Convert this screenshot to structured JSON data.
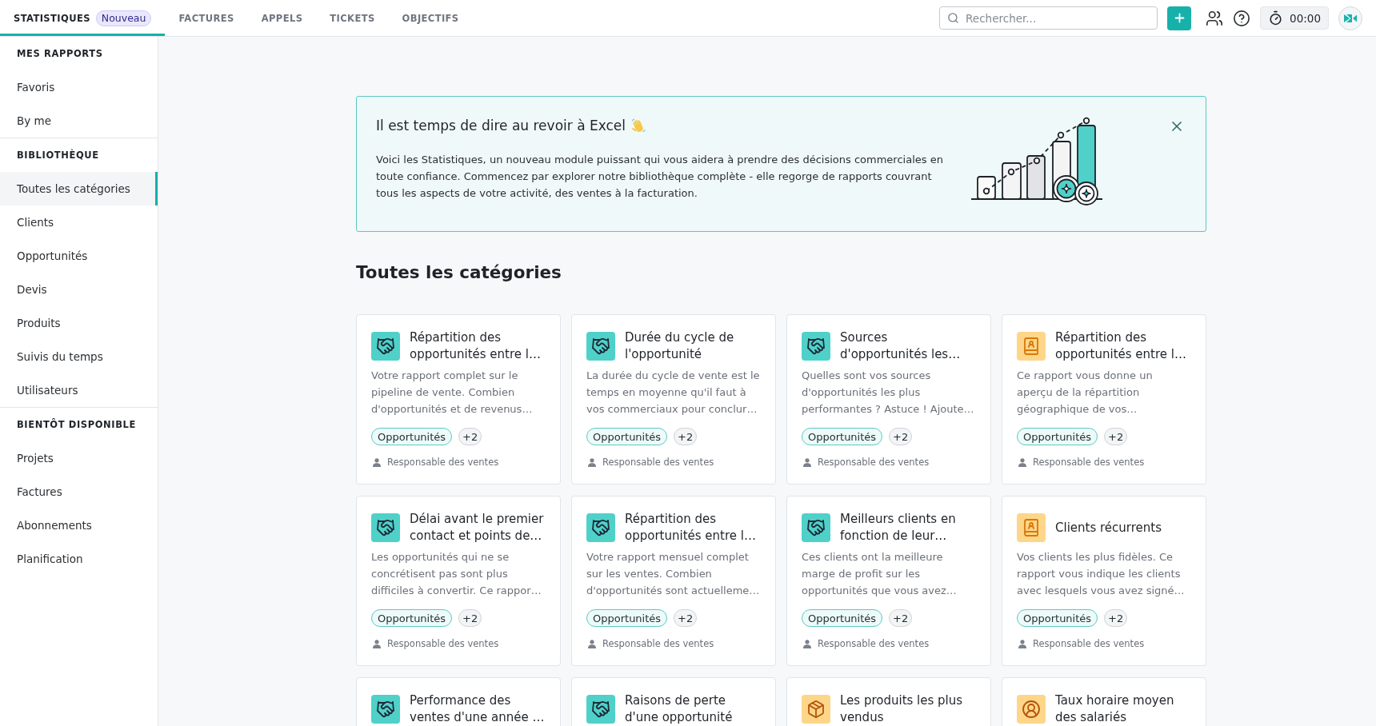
{
  "top_bar": {
    "tabs": [
      {
        "label": "STATISTIQUES",
        "badge": "Nouveau",
        "selected": true
      },
      {
        "label": "FACTURES",
        "selected": false
      },
      {
        "label": "APPELS",
        "selected": false
      },
      {
        "label": "TICKETS",
        "selected": false
      },
      {
        "label": "OBJECTIFS",
        "selected": false
      }
    ],
    "search": {
      "placeholder": "Rechercher..."
    },
    "timer": "00:00"
  },
  "sidebar": {
    "sections": [
      {
        "heading": "MES RAPPORTS",
        "items": [
          {
            "label": "Favoris",
            "selected": false
          },
          {
            "label": "By me",
            "selected": false
          }
        ]
      },
      {
        "heading": "BIBLIOTHÈQUE",
        "items": [
          {
            "label": "Toutes les catégories",
            "selected": true
          },
          {
            "label": "Clients",
            "selected": false
          },
          {
            "label": "Opportunités",
            "selected": false
          },
          {
            "label": "Devis",
            "selected": false
          },
          {
            "label": "Produits",
            "selected": false
          },
          {
            "label": "Suivis du temps",
            "selected": false
          },
          {
            "label": "Utilisateurs",
            "selected": false
          }
        ]
      },
      {
        "heading": "BIENTÔT DISPONIBLE",
        "items": [
          {
            "label": "Projets",
            "selected": false
          },
          {
            "label": "Factures",
            "selected": false
          },
          {
            "label": "Abonnements",
            "selected": false
          },
          {
            "label": "Planification",
            "selected": false
          }
        ]
      }
    ]
  },
  "banner": {
    "title": "Il est temps de dire au revoir à Excel",
    "text": "Voici les Statistiques, un nouveau module puissant qui vous aidera à prendre des décisions commerciales en toute confiance. Commencez par explorer notre bibliothèque complète - elle regorge de rapports couvrant tous les aspects de votre activité, des ventes à la facturation."
  },
  "library": {
    "heading": "Toutes les catégories",
    "cards": [
      {
        "kind": "deal",
        "title": "Répartition des opportunités entre l…",
        "description": "Votre rapport complet sur le\npipeline de vente. Combien\nd'opportunités et de revenus…",
        "tags": [
          {
            "label": "Opportunités",
            "kind": "category"
          },
          {
            "label": "+2",
            "kind": "more"
          }
        ],
        "audience": "Responsable des ventes"
      },
      {
        "kind": "deal",
        "title": "Durée du cycle de l'opportunité",
        "description": "La durée du cycle de vente est le\ntemps en moyenne qu'il faut à\nvos commerciaux pour conclur…",
        "tags": [
          {
            "label": "Opportunités",
            "kind": "category"
          },
          {
            "label": "+2",
            "kind": "more"
          }
        ],
        "audience": "Responsable des ventes"
      },
      {
        "kind": "deal",
        "title": "Sources d'opportunités les…",
        "description": "Quelles sont vos sources\nd'opportunités les plus\nperformantes ? Astuce ! Ajoute…",
        "tags": [
          {
            "label": "Opportunités",
            "kind": "category"
          },
          {
            "label": "+2",
            "kind": "more"
          }
        ],
        "audience": "Responsable des ventes"
      },
      {
        "kind": "contact",
        "title": "Répartition des opportunités entre l…",
        "description": "Ce rapport vous donne un\naperçu de la répartition\ngéographique de vos…",
        "tags": [
          {
            "label": "Opportunités",
            "kind": "category"
          },
          {
            "label": "+2",
            "kind": "more"
          }
        ],
        "audience": "Responsable des ventes"
      },
      {
        "kind": "deal",
        "title": "Délai avant le premier contact et points de…",
        "description": "Les opportunités qui ne se\nconcrétisent pas sont plus\ndifficiles à convertir. Ce rappor…",
        "tags": [
          {
            "label": "Opportunités",
            "kind": "category"
          },
          {
            "label": "+2",
            "kind": "more"
          }
        ],
        "audience": "Responsable des ventes"
      },
      {
        "kind": "deal",
        "title": "Répartition des opportunités entre l…",
        "description": "Votre rapport mensuel complet\nsur les ventes. Combien\nd'opportunités sont actuelleme…",
        "tags": [
          {
            "label": "Opportunités",
            "kind": "category"
          },
          {
            "label": "+2",
            "kind": "more"
          }
        ],
        "audience": "Responsable des ventes"
      },
      {
        "kind": "deal",
        "title": "Meilleurs clients en fonction de leur…",
        "description": "Ces clients ont la meilleure\nmarge de profit sur les\nopportunités que vous avez…",
        "tags": [
          {
            "label": "Opportunités",
            "kind": "category"
          },
          {
            "label": "+2",
            "kind": "more"
          }
        ],
        "audience": "Responsable des ventes"
      },
      {
        "kind": "contact",
        "title": "Clients récurrents",
        "description": "Vos clients les plus fidèles. Ce\nrapport vous indique les clients\navec lesquels vous avez signé…",
        "tags": [
          {
            "label": "Opportunités",
            "kind": "category"
          },
          {
            "label": "+2",
            "kind": "more"
          }
        ],
        "audience": "Responsable des ventes"
      },
      {
        "kind": "deal",
        "title": "Performance des ventes d'une année …"
      },
      {
        "kind": "deal",
        "title": "Raisons de perte d'une opportunité"
      },
      {
        "kind": "product",
        "title": "Les produits les plus vendus"
      },
      {
        "kind": "employee",
        "title": "Taux horaire moyen des salariés"
      }
    ]
  }
}
